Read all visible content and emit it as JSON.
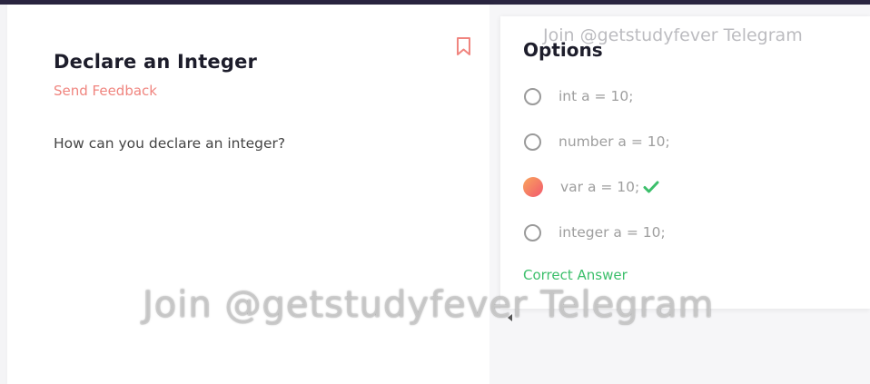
{
  "question": {
    "title": "Declare an Integer",
    "feedback_label": "Send Feedback",
    "text": "How can you declare an integer?"
  },
  "options_panel": {
    "title": "Options",
    "options": [
      {
        "label": "int a = 10;",
        "selected": false,
        "correct": false
      },
      {
        "label": "number a = 10;",
        "selected": false,
        "correct": false
      },
      {
        "label": "var a = 10;",
        "selected": true,
        "correct": true
      },
      {
        "label": "integer a = 10;",
        "selected": false,
        "correct": false
      }
    ],
    "result_label": "Correct Answer"
  },
  "watermark": {
    "top": "Join @getstudyfever Telegram",
    "center": "Join @getstudyfever Telegram"
  },
  "icons": {
    "bookmark": "bookmark-icon",
    "check": "check-icon"
  },
  "colors": {
    "accent_coral": "#f0857f",
    "success_green": "#3cbf6b",
    "topbar": "#2a2540",
    "selected_gradient_start": "#f9a65c",
    "selected_gradient_end": "#f2586e"
  }
}
